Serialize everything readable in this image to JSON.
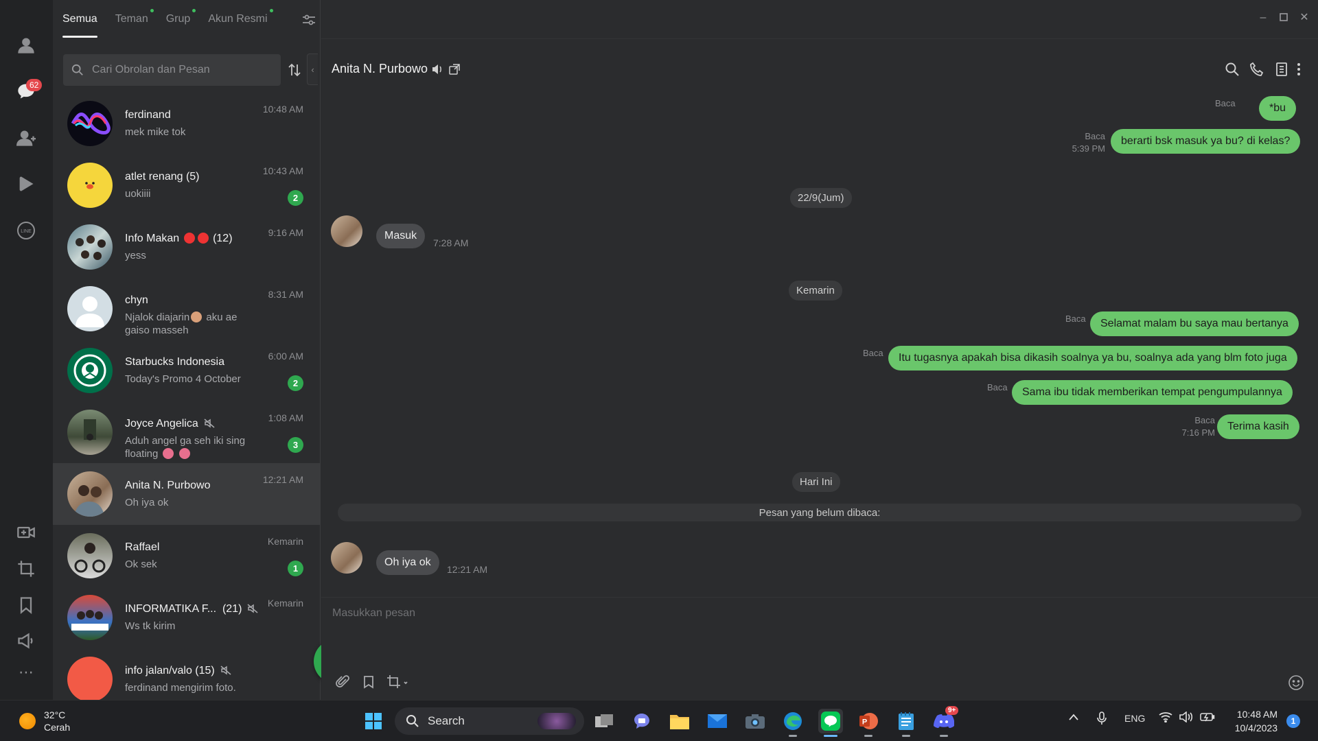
{
  "tabs": [
    {
      "label": "Semua",
      "dot": false
    },
    {
      "label": "Teman",
      "dot": true
    },
    {
      "label": "Grup",
      "dot": true
    },
    {
      "label": "Akun Resmi",
      "dot": true
    }
  ],
  "rail": {
    "chats_badge": "62"
  },
  "search": {
    "placeholder": "Cari Obrolan dan Pesan"
  },
  "chats": [
    {
      "name": "ferdinand",
      "preview": "mek mike tok",
      "time": "10:48 AM",
      "unread": "",
      "avatar": "infinity-logo"
    },
    {
      "name": "atlet renang (5)",
      "preview": "uokiiii",
      "time": "10:43 AM",
      "unread": "2",
      "avatar": "yellow-chick"
    },
    {
      "name": "Info Makan",
      "name_suffix": "(12)",
      "preview": "yess",
      "time": "9:16 AM",
      "unread": "",
      "avatar": "group-photo"
    },
    {
      "name": "chyn",
      "preview": "Njalok diajarin",
      "preview2": "aku ae gaiso masseh",
      "time": "8:31 AM",
      "unread": "",
      "avatar": "default-person"
    },
    {
      "name": "Starbucks Indonesia",
      "preview": "Today's Promo 4 October",
      "time": "6:00 AM",
      "unread": "2",
      "avatar": "starbucks-logo"
    },
    {
      "name": "Joyce Angelica",
      "preview": "Aduh angel ga seh iki sing floating",
      "time": "1:08 AM",
      "unread": "3",
      "avatar": "garden-photo",
      "muted": true
    },
    {
      "name": "Anita N. Purbowo",
      "preview": "Oh iya ok",
      "time": "12:21 AM",
      "unread": "",
      "avatar": "couple-photo",
      "selected": true
    },
    {
      "name": "Raffael",
      "preview": "Ok sek",
      "time": "Kemarin",
      "unread": "1",
      "avatar": "bike-photo"
    },
    {
      "name": "INFORMATIKA F...",
      "name_suffix": "(21)",
      "preview": "Ws tk kirim",
      "time": "Kemarin",
      "unread": "",
      "avatar": "full-senyum-photo",
      "muted": true
    },
    {
      "name": "info jalan/valo (15)",
      "preview": "ferdinand mengirim foto.",
      "time": "",
      "unread": "",
      "avatar": "red-circle",
      "muted": true
    }
  ],
  "conversation": {
    "contact_name": "Anita N. Purbowo",
    "messages": [
      {
        "dir": "out",
        "text": "*bu",
        "read": "Baca",
        "time": ""
      },
      {
        "dir": "out",
        "text": "berarti bsk masuk ya bu? di kelas?",
        "read": "Baca",
        "time": "5:39 PM"
      },
      {
        "dir": "date",
        "text": "22/9(Jum)"
      },
      {
        "dir": "in",
        "text": "Masuk",
        "time": "7:28 AM"
      },
      {
        "dir": "date",
        "text": "Kemarin"
      },
      {
        "dir": "out",
        "text": "Selamat malam bu saya mau bertanya",
        "read": "Baca",
        "time": ""
      },
      {
        "dir": "out",
        "text": "Itu tugasnya apakah bisa dikasih soalnya ya bu, soalnya ada yang blm foto juga",
        "read": "Baca",
        "time": ""
      },
      {
        "dir": "out",
        "text": "Sama ibu tidak memberikan tempat pengumpulannya",
        "read": "Baca",
        "time": ""
      },
      {
        "dir": "out",
        "text": "Terima kasih",
        "read": "Baca",
        "time": "7:16 PM"
      },
      {
        "dir": "date",
        "text": "Hari Ini"
      },
      {
        "dir": "unread-divider",
        "text": "Pesan yang belum dibaca:"
      },
      {
        "dir": "in",
        "text": "Oh iya ok",
        "time": "12:21 AM"
      }
    ]
  },
  "composer": {
    "placeholder": "Masukkan pesan"
  },
  "taskbar": {
    "temperature": "32°C",
    "weather": "Cerah",
    "search_label": "Search",
    "language": "ENG",
    "time": "10:48 AM",
    "date": "10/4/2023",
    "notifications": "1",
    "discord_badge": "9+"
  },
  "colors": {
    "accent": "#6ac66b",
    "badge": "#2fa84f",
    "alert": "#e5484d"
  }
}
